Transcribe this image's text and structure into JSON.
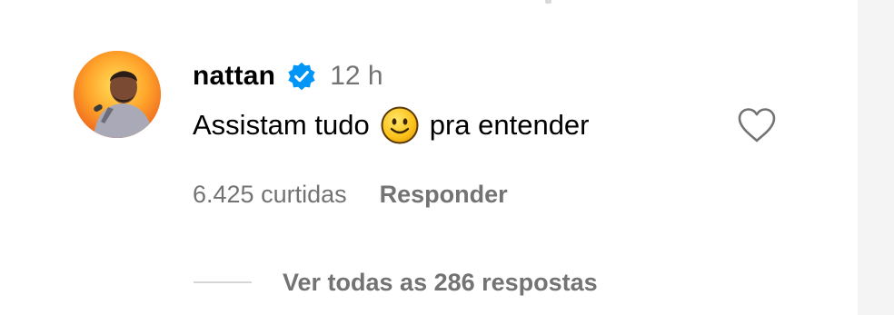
{
  "comment": {
    "avatar": {
      "icon": "user-avatar",
      "ring_color": "#ff9d1e"
    },
    "username": "nattan",
    "verified_icon": "verified-badge-icon",
    "verified_color": "#0095f6",
    "timestamp": "12 h",
    "text_before": "Assistam tudo",
    "emoji": "slightly-smiling-face-emoji",
    "text_after": "pra entender",
    "like_icon": "heart-outline-icon",
    "likes_count": "6.425 curtidas",
    "reply_label": "Responder",
    "view_replies": "Ver todas as 286 respostas"
  },
  "colors": {
    "primary_text": "#000000",
    "secondary_text": "#737373",
    "background": "#ffffff"
  }
}
